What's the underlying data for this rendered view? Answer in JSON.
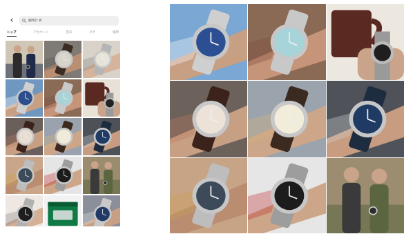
{
  "search": {
    "query": "腕時計 男"
  },
  "tabs": [
    {
      "label": "トップ",
      "active": true
    },
    {
      "label": "アカウント",
      "active": false
    },
    {
      "label": "音声",
      "active": false
    },
    {
      "label": "タグ",
      "active": false
    },
    {
      "label": "場所",
      "active": false
    }
  ],
  "icons": {
    "back": "chevron-left-icon",
    "search": "search-icon"
  },
  "colors": {
    "tab_active": "#111111",
    "tab_inactive": "#999999",
    "search_bg": "#efefef"
  },
  "phone_grid": [
    {
      "name": "post-couple-photo",
      "bg": "#cfc6b6",
      "skin": "#c9a48a",
      "strap": "#2b2b2b",
      "dial": "#2d2d2d",
      "accent": "#1f2b48",
      "kind": "people"
    },
    {
      "name": "post-wrist-leather",
      "bg": "#7f7a73",
      "skin": "#b98f73",
      "strap": "#3a2c22",
      "dial": "#d8d4cc",
      "accent": "#555",
      "kind": "wrist"
    },
    {
      "name": "post-wrist-bracelet",
      "bg": "#d9d2c8",
      "skin": "#d6b49b",
      "strap": "#b5b5b5",
      "dial": "#e8e3d9",
      "accent": "#888",
      "kind": "wrist"
    },
    {
      "name": "post-blue-dial-sea",
      "bg": "#6f97c0",
      "skin": "#c79f83",
      "strap": "#cfcfcf",
      "dial": "#2c4e8d",
      "accent": "#fff",
      "kind": "wrist"
    },
    {
      "name": "post-ice-blue-daytona",
      "bg": "#8a6b56",
      "skin": "#c69478",
      "strap": "#c9c9c9",
      "dial": "#a9d3d6",
      "accent": "#7b4d3e",
      "kind": "wrist"
    },
    {
      "name": "post-mug-watch",
      "bg": "#e7e1d7",
      "skin": "#c9a48a",
      "strap": "#9a9a9a",
      "dial": "#222",
      "accent": "#5a2a22",
      "kind": "mug"
    },
    {
      "name": "post-rose-gold-leather",
      "bg": "#6a5f5a",
      "skin": "#c79f83",
      "strap": "#3b221b",
      "dial": "#e8ddd3",
      "accent": "#b77b5f",
      "kind": "wrist"
    },
    {
      "name": "post-gold-shirt-cuff",
      "bg": "#9aa2ad",
      "skin": "#cda68a",
      "strap": "#3b2a20",
      "dial": "#f0ead8",
      "accent": "#d4b17a",
      "kind": "wrist"
    },
    {
      "name": "post-blue-chrono-hand",
      "bg": "#4e5258",
      "skin": "#c89c80",
      "strap": "#1e2c40",
      "dial": "#1f3a63",
      "accent": "#cfcfcf",
      "kind": "wrist"
    },
    {
      "name": "post-ap-bracelets",
      "bg": "#c9a689",
      "skin": "#bb8d70",
      "strap": "#bdbdbd",
      "dial": "#3c4a5a",
      "accent": "#c8a050",
      "kind": "wrist"
    },
    {
      "name": "post-pepsi-street",
      "bg": "#e5e5e5",
      "skin": "#cda68a",
      "strap": "#9d9d9d",
      "dial": "#1c1c1c",
      "accent": "#c03030",
      "kind": "wrist"
    },
    {
      "name": "post-street-fashion",
      "bg": "#9b8b6f",
      "skin": "#c9a48a",
      "strap": "#3a3a3a",
      "dial": "#2d2d2d",
      "accent": "#5b6640",
      "kind": "people"
    },
    {
      "name": "post-black-dial-sleeve",
      "bg": "#efe7e1",
      "skin": "#d3b096",
      "strap": "#b0b0b0",
      "dial": "#1e1e1e",
      "accent": "#8a8a8a",
      "kind": "wrist"
    },
    {
      "name": "post-green-box",
      "bg": "#f2f2f2",
      "skin": "#c9a48a",
      "strap": "#0f7a45",
      "dial": "#0f7a45",
      "accent": "#e8e8e8",
      "kind": "box"
    },
    {
      "name": "post-navy-dial-grey",
      "bg": "#8b8f99",
      "skin": "#c79f83",
      "strap": "#c9c9c9",
      "dial": "#233a66",
      "accent": "#e0e0e0",
      "kind": "wrist"
    }
  ],
  "large_grid": [
    {
      "name": "photo-blue-dial-sea",
      "bg": "#7aa7d3",
      "skin": "#c79f83",
      "strap": "#cfcfcf",
      "dial": "#2b4f92",
      "accent": "#ffffff",
      "kind": "wrist"
    },
    {
      "name": "photo-ice-blue-daytona",
      "bg": "#8b6a55",
      "skin": "#c69478",
      "strap": "#c8c8c8",
      "dial": "#a6d4d8",
      "accent": "#7a4a3b",
      "kind": "wrist"
    },
    {
      "name": "photo-mug-watch",
      "bg": "#ede8df",
      "skin": "#c9a48a",
      "strap": "#9a9a9a",
      "dial": "#1e1e1e",
      "accent": "#5a2a22",
      "kind": "mug"
    },
    {
      "name": "photo-rose-gold-leather",
      "bg": "#6d615b",
      "skin": "#c79f83",
      "strap": "#3b221b",
      "dial": "#ece2d7",
      "accent": "#b77b5f",
      "kind": "wrist"
    },
    {
      "name": "photo-gold-shirt-cuff",
      "bg": "#9ba3ad",
      "skin": "#cda68a",
      "strap": "#3b2a20",
      "dial": "#f2ecda",
      "accent": "#d4b17a",
      "kind": "wrist"
    },
    {
      "name": "photo-blue-chrono-hand",
      "bg": "#4f5359",
      "skin": "#c89c80",
      "strap": "#1e2c40",
      "dial": "#1f3a63",
      "accent": "#d0d0d0",
      "kind": "wrist"
    },
    {
      "name": "photo-ap-bracelets",
      "bg": "#c8a487",
      "skin": "#bb8d70",
      "strap": "#bdbdbd",
      "dial": "#3c4a5a",
      "accent": "#c8a050",
      "kind": "wrist"
    },
    {
      "name": "photo-pepsi-street",
      "bg": "#e6e6e6",
      "skin": "#cda68a",
      "strap": "#9d9d9d",
      "dial": "#1c1c1c",
      "accent": "#c03030",
      "kind": "wrist"
    },
    {
      "name": "photo-street-fashion",
      "bg": "#9c8c70",
      "skin": "#c9a48a",
      "strap": "#3a3a3a",
      "dial": "#2d2d2d",
      "accent": "#5b6640",
      "kind": "people"
    }
  ]
}
